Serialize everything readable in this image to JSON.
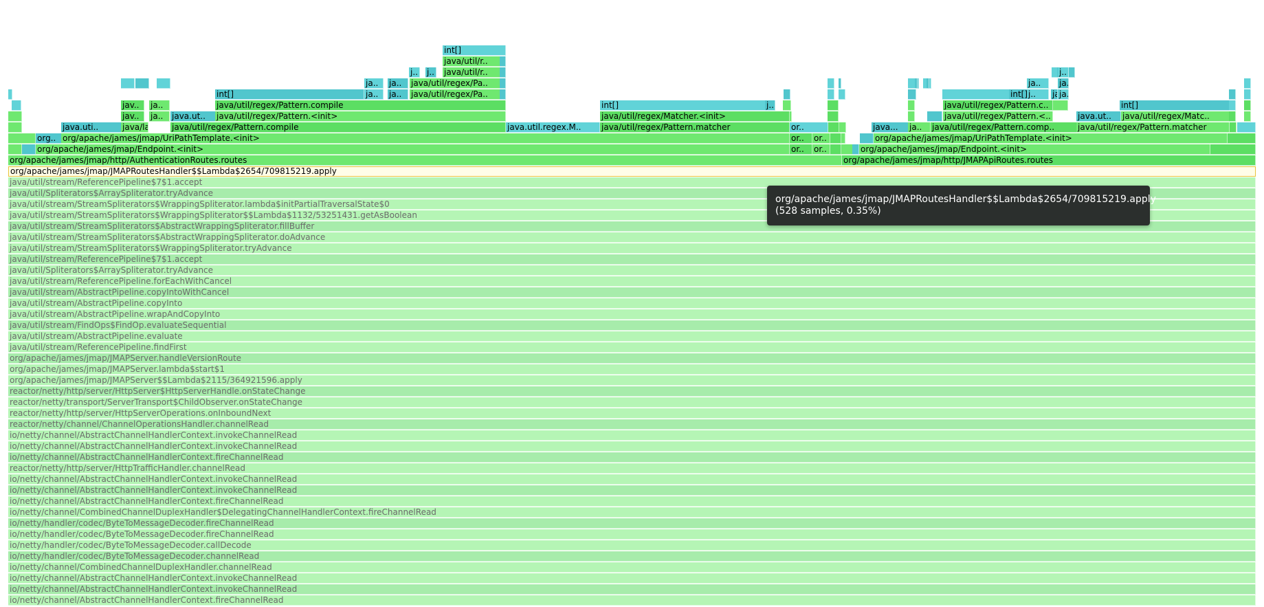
{
  "colors": {
    "green": "#6fe870",
    "green_alt": "#5cde63",
    "cyan": "#61d3d8",
    "cyan_alt": "#51c6cd",
    "pale": "#b5f5b5",
    "pale_alt": "#a7ecab",
    "selected_border": "#e8c43a",
    "tooltip_bg": "#2b2f2d"
  },
  "tooltip": {
    "name": "org/apache/james/jmap/JMAPRoutesHandler$$Lambda$2654/709815219.apply",
    "stats": "(528 samples, 0.35%)"
  },
  "rows": [
    [
      {
        "label": "int[]",
        "kind": "cyan"
      }
    ],
    [
      {
        "label": "java/util/r..",
        "kind": "green"
      },
      {
        "label": "",
        "kind": "cyan"
      }
    ],
    [
      {
        "label": "j..",
        "kind": "cyan"
      },
      {
        "label": "j..",
        "kind": "cyan"
      },
      {
        "label": "java/util/r..",
        "kind": "green"
      },
      {
        "label": "",
        "kind": "cyan"
      },
      {
        "label": "",
        "kind": "cyan"
      },
      {
        "label": "",
        "kind": "cyan"
      },
      {
        "label": "j..",
        "kind": "cyan"
      },
      {
        "label": "",
        "kind": "cyan"
      }
    ],
    [
      {
        "label": "",
        "kind": "cyan"
      },
      {
        "label": "",
        "kind": "cyan"
      },
      {
        "label": "",
        "kind": "cyan"
      },
      {
        "label": "",
        "kind": "cyan"
      },
      {
        "label": "",
        "kind": "cyan"
      },
      {
        "label": "",
        "kind": "cyan"
      },
      {
        "label": "ja..",
        "kind": "cyan"
      },
      {
        "label": "ja..",
        "kind": "cyan"
      },
      {
        "label": "java/util/regex/Pa..",
        "kind": "green"
      },
      {
        "label": "",
        "kind": "cyan"
      },
      {
        "label": "",
        "kind": "cyan"
      },
      {
        "label": "",
        "kind": "cyan"
      },
      {
        "label": "",
        "kind": "cyan"
      },
      {
        "label": "",
        "kind": "cyan"
      },
      {
        "label": "ja..",
        "kind": "cyan"
      },
      {
        "label": "ja..",
        "kind": "cyan"
      },
      {
        "label": "",
        "kind": "cyan"
      }
    ],
    [
      {
        "label": "",
        "kind": "cyan"
      },
      {
        "label": "",
        "kind": "cyan"
      },
      {
        "label": "",
        "kind": "cyan"
      },
      {
        "label": "int[]",
        "kind": "cyan"
      },
      {
        "label": "ja..",
        "kind": "cyan"
      },
      {
        "label": "ja..",
        "kind": "cyan"
      },
      {
        "label": "java/util/regex/Pa..",
        "kind": "green"
      },
      {
        "label": "",
        "kind": "cyan"
      },
      {
        "label": "",
        "kind": "cyan"
      },
      {
        "label": "",
        "kind": "cyan"
      },
      {
        "label": "",
        "kind": "cyan"
      },
      {
        "label": "int[]",
        "kind": "cyan"
      },
      {
        "label": "j..",
        "kind": "cyan"
      },
      {
        "label": "ja..",
        "kind": "cyan"
      },
      {
        "label": "ja..",
        "kind": "cyan"
      },
      {
        "label": "",
        "kind": "cyan"
      },
      {
        "label": "",
        "kind": "cyan"
      }
    ],
    [
      {
        "label": "",
        "kind": "cyan"
      },
      {
        "label": "jav..",
        "kind": "green"
      },
      {
        "label": "ja..",
        "kind": "green"
      },
      {
        "label": "java/util/regex/Pattern.compile",
        "kind": "green"
      },
      {
        "label": "int[]",
        "kind": "cyan"
      },
      {
        "label": "j..",
        "kind": "cyan"
      },
      {
        "label": "",
        "kind": "green"
      },
      {
        "label": "",
        "kind": "green"
      },
      {
        "label": "",
        "kind": "green"
      },
      {
        "label": "java/util/regex/Pattern.c..",
        "kind": "green"
      },
      {
        "label": "",
        "kind": "green"
      },
      {
        "label": "int[]",
        "kind": "cyan"
      },
      {
        "label": "",
        "kind": "cyan"
      },
      {
        "label": "",
        "kind": "green"
      }
    ],
    [
      {
        "label": "",
        "kind": "green"
      },
      {
        "label": "jav..",
        "kind": "green"
      },
      {
        "label": "ja..",
        "kind": "green"
      },
      {
        "label": "java.ut..",
        "kind": "cyan"
      },
      {
        "label": "java/util/regex/Pattern.<init>",
        "kind": "green"
      },
      {
        "label": "java/util/regex/Matcher.<init>",
        "kind": "green"
      },
      {
        "label": "",
        "kind": "green"
      },
      {
        "label": "",
        "kind": "green"
      },
      {
        "label": "",
        "kind": "green"
      },
      {
        "label": "",
        "kind": "cyan"
      },
      {
        "label": "java/util/regex/Pattern.<..",
        "kind": "green"
      },
      {
        "label": "java.ut..",
        "kind": "cyan"
      },
      {
        "label": "java/util/regex/Matc..",
        "kind": "green"
      },
      {
        "label": "",
        "kind": "green"
      },
      {
        "label": "",
        "kind": "green"
      }
    ],
    [
      {
        "label": "",
        "kind": "green"
      },
      {
        "label": "java.uti..",
        "kind": "cyan"
      },
      {
        "label": "java/lan..",
        "kind": "green"
      },
      {
        "label": "java/util/regex/Pattern.compile",
        "kind": "green"
      },
      {
        "label": "java.util.regex.M..",
        "kind": "cyan"
      },
      {
        "label": "java/util/regex/Pattern.matcher",
        "kind": "green"
      },
      {
        "label": "or..",
        "kind": "cyan"
      },
      {
        "label": "",
        "kind": "green"
      },
      {
        "label": "",
        "kind": "green"
      },
      {
        "label": "java...",
        "kind": "cyan"
      },
      {
        "label": "ja..",
        "kind": "green"
      },
      {
        "label": "java/util/regex/Pattern.comp..",
        "kind": "green"
      },
      {
        "label": "java/util/regex/Pattern.matcher",
        "kind": "green"
      },
      {
        "label": "",
        "kind": "green"
      },
      {
        "label": "",
        "kind": "cyan"
      }
    ],
    [
      {
        "label": "",
        "kind": "green"
      },
      {
        "label": "org..",
        "kind": "cyan"
      },
      {
        "label": "org/apache/james/jmap/UriPathTemplate.<init>",
        "kind": "green"
      },
      {
        "label": "or..",
        "kind": "green"
      },
      {
        "label": "or..",
        "kind": "green"
      },
      {
        "label": "",
        "kind": "green"
      },
      {
        "label": "",
        "kind": "green"
      },
      {
        "label": "",
        "kind": "cyan"
      },
      {
        "label": "org/apache/james/jmap/UriPathTemplate.<init>",
        "kind": "green"
      },
      {
        "label": "",
        "kind": "green"
      }
    ],
    [
      {
        "label": "",
        "kind": "green"
      },
      {
        "label": "",
        "kind": "cyan"
      },
      {
        "label": "org/apache/james/jmap/Endpoint.<init>",
        "kind": "green"
      },
      {
        "label": "or..",
        "kind": "green"
      },
      {
        "label": "or..",
        "kind": "green"
      },
      {
        "label": "",
        "kind": "green"
      },
      {
        "label": "",
        "kind": "green"
      },
      {
        "label": "",
        "kind": "cyan"
      },
      {
        "label": "org/apache/james/jmap/Endpoint.<init>",
        "kind": "green"
      },
      {
        "label": "",
        "kind": "green"
      }
    ],
    [
      {
        "label": "org/apache/james/jmap/http/AuthenticationRoutes.routes",
        "kind": "green"
      },
      {
        "label": "org/apache/james/jmap/http/JMAPApiRoutes.routes",
        "kind": "green"
      }
    ],
    [
      {
        "label": "org/apache/james/jmap/JMAPRoutesHandler$$Lambda$2654/709815219.apply",
        "kind": "sel"
      }
    ]
  ],
  "stack": [
    "java/util/stream/ReferencePipeline$7$1.accept",
    "java/util/Spliterators$ArraySpliterator.tryAdvance",
    "java/util/stream/StreamSpliterators$WrappingSpliterator.lambda$initPartialTraversalState$0",
    "java/util/stream/StreamSpliterators$WrappingSpliterator$$Lambda$1132/53251431.getAsBoolean",
    "java/util/stream/StreamSpliterators$AbstractWrappingSpliterator.fillBuffer",
    "java/util/stream/StreamSpliterators$AbstractWrappingSpliterator.doAdvance",
    "java/util/stream/StreamSpliterators$WrappingSpliterator.tryAdvance",
    "java/util/stream/ReferencePipeline$7$1.accept",
    "java/util/Spliterators$ArraySpliterator.tryAdvance",
    "java/util/stream/ReferencePipeline.forEachWithCancel",
    "java/util/stream/AbstractPipeline.copyIntoWithCancel",
    "java/util/stream/AbstractPipeline.copyInto",
    "java/util/stream/AbstractPipeline.wrapAndCopyInto",
    "java/util/stream/FindOps$FindOp.evaluateSequential",
    "java/util/stream/AbstractPipeline.evaluate",
    "java/util/stream/ReferencePipeline.findFirst",
    "org/apache/james/jmap/JMAPServer.handleVersionRoute",
    "org/apache/james/jmap/JMAPServer.lambda$start$1",
    "org/apache/james/jmap/JMAPServer$$Lambda$2115/364921596.apply",
    "reactor/netty/http/server/HttpServer$HttpServerHandle.onStateChange",
    "reactor/netty/transport/ServerTransport$ChildObserver.onStateChange",
    "reactor/netty/http/server/HttpServerOperations.onInboundNext",
    "reactor/netty/channel/ChannelOperationsHandler.channelRead",
    "io/netty/channel/AbstractChannelHandlerContext.invokeChannelRead",
    "io/netty/channel/AbstractChannelHandlerContext.invokeChannelRead",
    "io/netty/channel/AbstractChannelHandlerContext.fireChannelRead",
    "reactor/netty/http/server/HttpTrafficHandler.channelRead",
    "io/netty/channel/AbstractChannelHandlerContext.invokeChannelRead",
    "io/netty/channel/AbstractChannelHandlerContext.invokeChannelRead",
    "io/netty/channel/AbstractChannelHandlerContext.fireChannelRead",
    "io/netty/channel/CombinedChannelDuplexHandler$DelegatingChannelHandlerContext.fireChannelRead",
    "io/netty/handler/codec/ByteToMessageDecoder.fireChannelRead",
    "io/netty/handler/codec/ByteToMessageDecoder.fireChannelRead",
    "io/netty/handler/codec/ByteToMessageDecoder.callDecode",
    "io/netty/handler/codec/ByteToMessageDecoder.channelRead",
    "io/netty/channel/CombinedChannelDuplexHandler.channelRead",
    "io/netty/channel/AbstractChannelHandlerContext.invokeChannelRead",
    "io/netty/channel/AbstractChannelHandlerContext.invokeChannelRead",
    "io/netty/channel/AbstractChannelHandlerContext.fireChannelRead"
  ]
}
